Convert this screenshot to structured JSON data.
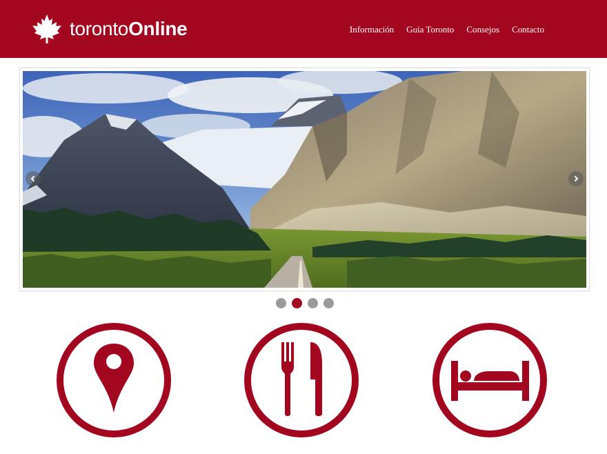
{
  "header": {
    "logo_light": "toronto",
    "logo_bold": "Online",
    "logo_icon": "maple-leaf-icon"
  },
  "nav": {
    "items": [
      {
        "label": "Información"
      },
      {
        "label": "Guía Toronto"
      },
      {
        "label": "Consejos"
      },
      {
        "label": "Contacto"
      }
    ]
  },
  "slider": {
    "image": "mountain-road-landscape",
    "prev_icon": "chevron-left-icon",
    "next_icon": "chevron-right-icon",
    "total_slides": 4,
    "active_slide": 2
  },
  "features": [
    {
      "icon": "map-pin-icon"
    },
    {
      "icon": "fork-knife-icon"
    },
    {
      "icon": "bed-icon"
    }
  ],
  "colors": {
    "brand": "#a3061f",
    "dot_inactive": "#9a9a9a",
    "text_on_brand": "#ffffff"
  }
}
